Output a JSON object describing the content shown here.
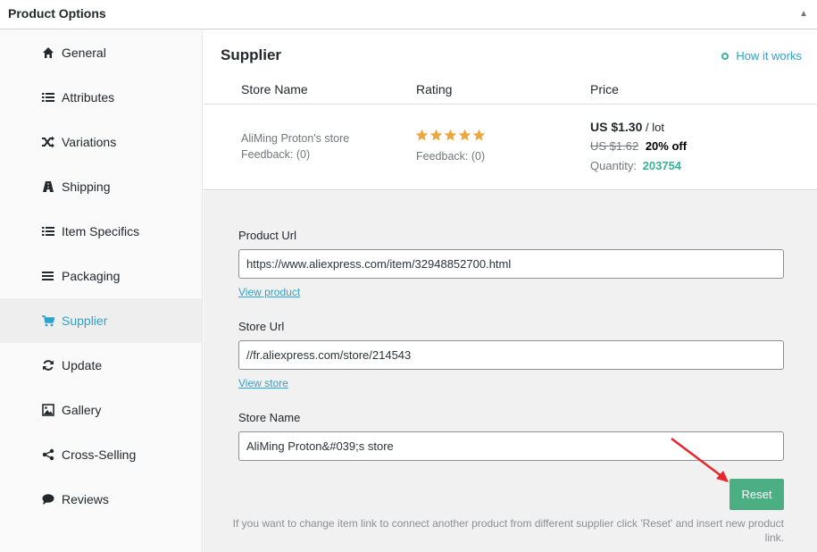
{
  "header": {
    "title": "Product Options",
    "toggle_icon": "caret-up-icon"
  },
  "sidebar": {
    "items": [
      {
        "label": "General",
        "icon": "home-icon",
        "active": false
      },
      {
        "label": "Attributes",
        "icon": "list-icon",
        "active": false
      },
      {
        "label": "Variations",
        "icon": "shuffle-icon",
        "active": false
      },
      {
        "label": "Shipping",
        "icon": "truck-icon",
        "active": false
      },
      {
        "label": "Item Specifics",
        "icon": "list-icon",
        "active": false
      },
      {
        "label": "Packaging",
        "icon": "menu-icon",
        "active": false
      },
      {
        "label": "Supplier",
        "icon": "cart-icon",
        "active": true
      },
      {
        "label": "Update",
        "icon": "refresh-icon",
        "active": false
      },
      {
        "label": "Gallery",
        "icon": "image-icon",
        "active": false
      },
      {
        "label": "Cross-Selling",
        "icon": "share-icon",
        "active": false
      },
      {
        "label": "Reviews",
        "icon": "comment-icon",
        "active": false
      }
    ]
  },
  "supplier": {
    "title": "Supplier",
    "how_it_works": "How it works",
    "columns": {
      "store": "Store Name",
      "rating": "Rating",
      "price": "Price"
    },
    "store_name": "AliMing Proton's store",
    "store_feedback": "Feedback: (0)",
    "rating_stars": 5,
    "rating_feedback": "Feedback: (0)",
    "price_current": "US $1.30",
    "price_unit": "/ lot",
    "price_old": "US $1.62",
    "discount": "20% off",
    "quantity_label": "Quantity:",
    "quantity_value": "203754"
  },
  "form": {
    "product_url_label": "Product Url",
    "product_url_value": "https://www.aliexpress.com/item/32948852700.html",
    "view_product": "View product",
    "store_url_label": "Store Url",
    "store_url_value": "//fr.aliexpress.com/store/214543",
    "view_store": "View store",
    "store_name_label": "Store Name",
    "store_name_value": "AliMing Proton&#039;s store",
    "reset_label": "Reset",
    "note": "If you want to change item link to connect another product from different supplier click 'Reset' and insert new product link."
  },
  "colors": {
    "accent": "#2ea2cc",
    "success": "#3bb09a",
    "button": "#4caf84",
    "star": "#f0a53a",
    "arrow": "#e8262b"
  }
}
